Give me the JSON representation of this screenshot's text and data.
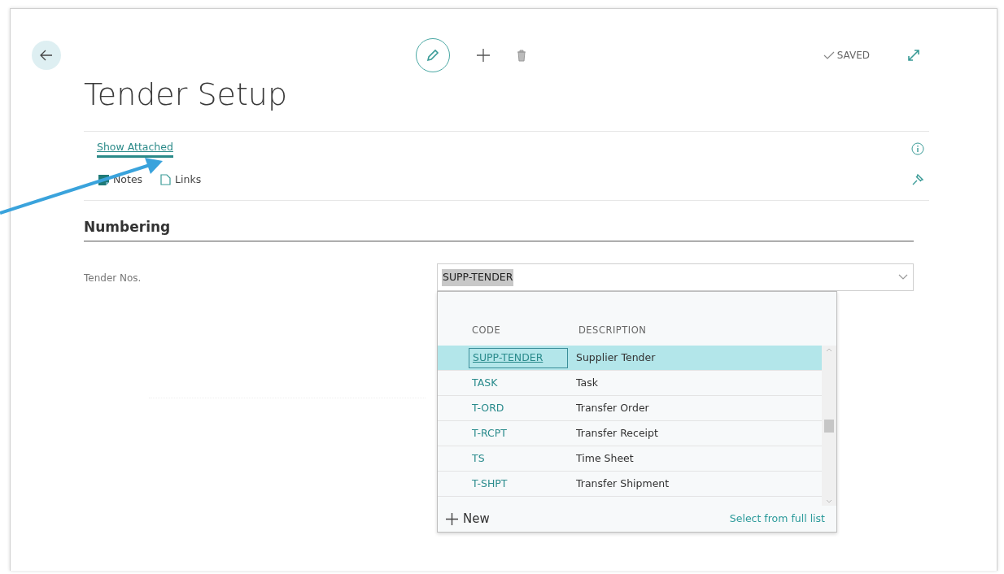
{
  "page": {
    "title": "Tender Setup",
    "status": "SAVED"
  },
  "actions": [
    {
      "label": "Show Attached",
      "selected": true
    }
  ],
  "factboxes": [
    {
      "kind": "notes",
      "label": "Notes"
    },
    {
      "kind": "links",
      "label": "Links"
    }
  ],
  "section": {
    "title": "Numbering",
    "field": {
      "label": "Tender Nos.",
      "value": "SUPP-TENDER"
    }
  },
  "lookup": {
    "columns": [
      "CODE",
      "DESCRIPTION"
    ],
    "rows": [
      {
        "code": "SUPP-TENDER",
        "description": "Supplier Tender",
        "selected": true
      },
      {
        "code": "TASK",
        "description": "Task",
        "selected": false
      },
      {
        "code": "T-ORD",
        "description": "Transfer Order",
        "selected": false
      },
      {
        "code": "T-RCPT",
        "description": "Transfer Receipt",
        "selected": false
      },
      {
        "code": "TS",
        "description": "Time Sheet",
        "selected": false
      },
      {
        "code": "T-SHPT",
        "description": "Transfer Shipment",
        "selected": false
      }
    ],
    "new_label": "New",
    "full_list": "Select from full list"
  }
}
